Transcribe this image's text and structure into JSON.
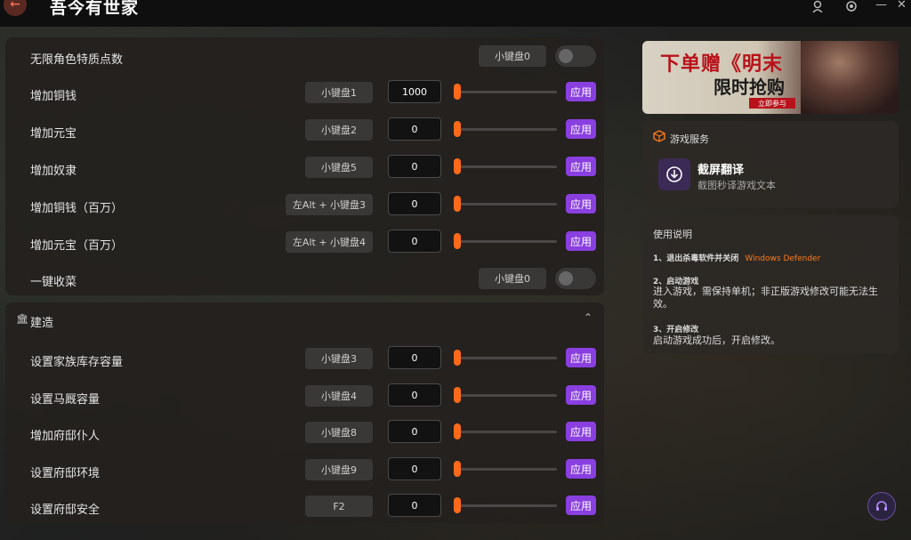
{
  "app": {
    "title": "吾今有世家"
  },
  "top_rows": [
    {
      "label": "无限角色特质点数",
      "key": "小键盘0",
      "type": "toggle"
    },
    {
      "label": "增加铜钱",
      "key": "小键盘1",
      "value": "1000",
      "type": "slider",
      "apply": "应用"
    },
    {
      "label": "增加元宝",
      "key": "小键盘2",
      "value": "0",
      "type": "slider",
      "apply": "应用"
    },
    {
      "label": "增加奴隶",
      "key": "小键盘5",
      "value": "0",
      "type": "slider",
      "apply": "应用"
    },
    {
      "label": "增加铜钱（百万）",
      "key": "左Alt + 小键盘3",
      "value": "0",
      "type": "slider",
      "apply": "应用"
    },
    {
      "label": "增加元宝（百万）",
      "key": "左Alt + 小键盘4",
      "value": "0",
      "type": "slider",
      "apply": "应用"
    },
    {
      "label": "一键收菜",
      "key": "小键盘0",
      "type": "toggle"
    }
  ],
  "build_section": {
    "title": "建造",
    "rows": [
      {
        "label": "设置家族库存容量",
        "key": "小键盘3",
        "value": "0",
        "apply": "应用"
      },
      {
        "label": "设置马厩容量",
        "key": "小键盘4",
        "value": "0",
        "apply": "应用"
      },
      {
        "label": "增加府邸仆人",
        "key": "小键盘8",
        "value": "0",
        "apply": "应用"
      },
      {
        "label": "设置府邸环境",
        "key": "小键盘9",
        "value": "0",
        "apply": "应用"
      },
      {
        "label": "设置府邸安全",
        "key": "F2",
        "value": "0",
        "apply": "应用"
      }
    ]
  },
  "banner": {
    "headline": "下单赠《明末",
    "subline": "限时抢购",
    "cta": "立即参与"
  },
  "game_service": {
    "title": "游戏服务",
    "item_title": "截屏翻译",
    "item_desc": "截图秒译游戏文本"
  },
  "instructions": {
    "title": "使用说明",
    "step1_title": "1、退出杀毒软件并关闭",
    "step1_highlight": "Windows Defender",
    "step2_title": "2、启动游戏",
    "step2_text": "进入游戏，需保持单机；非正版游戏修改可能无法生效。",
    "step3_title": "3、开启修改",
    "step3_text": "启动游戏成功后，开启修改。"
  },
  "colors": {
    "accent_purple": "#8a3fe0",
    "accent_orange": "#ff6a1a",
    "highlight_orange": "#ff7a1a"
  }
}
